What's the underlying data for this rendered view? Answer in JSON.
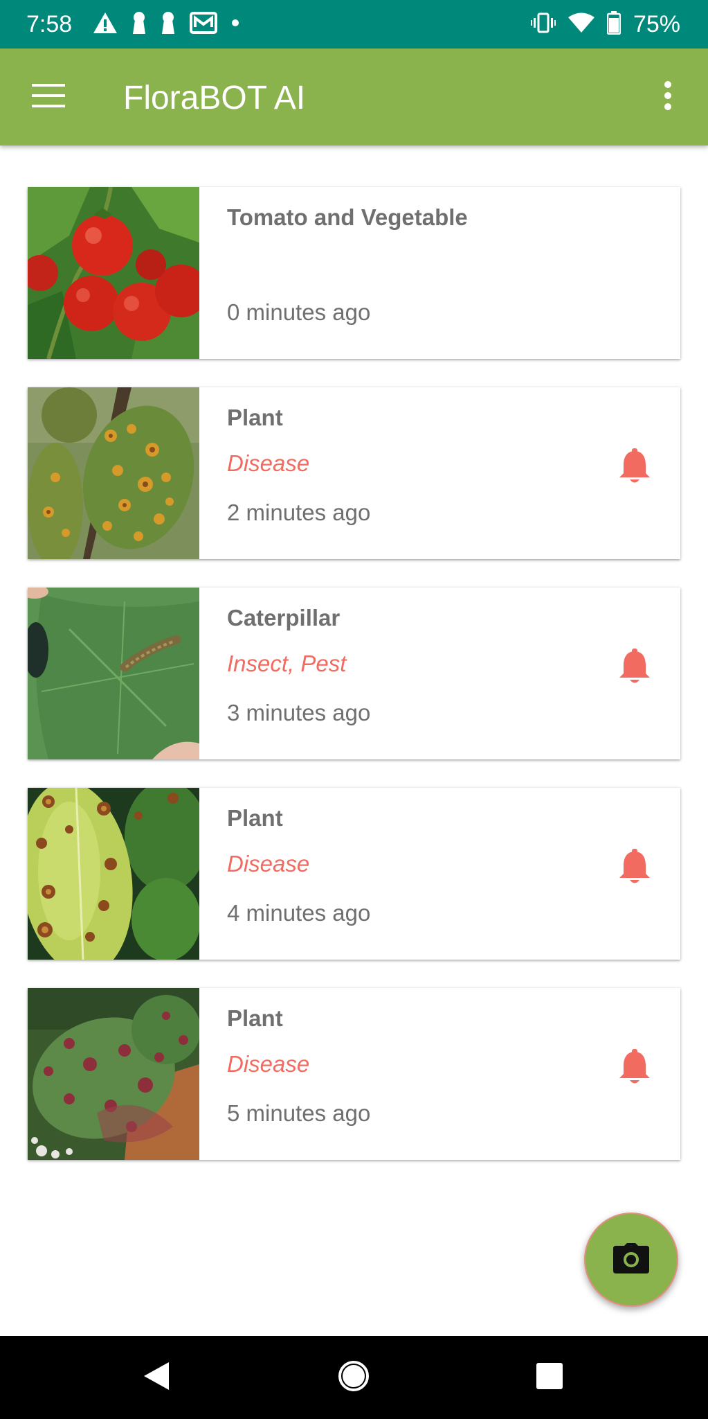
{
  "status_bar": {
    "time": "7:58",
    "battery": "75%",
    "left_icons": [
      "alert-icon",
      "keyhole-icon",
      "keyhole-icon",
      "gmail-icon",
      "dot-icon"
    ],
    "right_icons": [
      "vibrate-icon",
      "wifi-icon",
      "battery-icon"
    ]
  },
  "app_bar": {
    "title": "FloraBOT AI",
    "menu_icon": "hamburger-menu-icon",
    "overflow_icon": "more-vert-icon",
    "color": "#8bb34d"
  },
  "detections": [
    {
      "title": "Tomato and Vegetable",
      "tag": "",
      "time": "0 minutes ago",
      "alert": false,
      "thumbnail": "tomato-photo"
    },
    {
      "title": "Plant",
      "tag": "Disease",
      "time": "2 minutes ago",
      "alert": true,
      "thumbnail": "leaf-rust-photo"
    },
    {
      "title": "Caterpillar",
      "tag": "Insect, Pest",
      "time": "3 minutes ago",
      "alert": true,
      "thumbnail": "caterpillar-photo"
    },
    {
      "title": "Plant",
      "tag": "Disease",
      "time": "4 minutes ago",
      "alert": true,
      "thumbnail": "leaf-spot-photo"
    },
    {
      "title": "Plant",
      "tag": "Disease",
      "time": "5 minutes ago",
      "alert": true,
      "thumbnail": "leaf-blight-photo"
    }
  ],
  "fab": {
    "icon": "camera-icon"
  },
  "colors": {
    "status_bar": "#00897b",
    "accent_alert": "#f26b60",
    "text_secondary": "#6f6f6f"
  },
  "nav_bar": {
    "buttons": [
      "back-icon",
      "home-icon",
      "recents-icon"
    ]
  }
}
